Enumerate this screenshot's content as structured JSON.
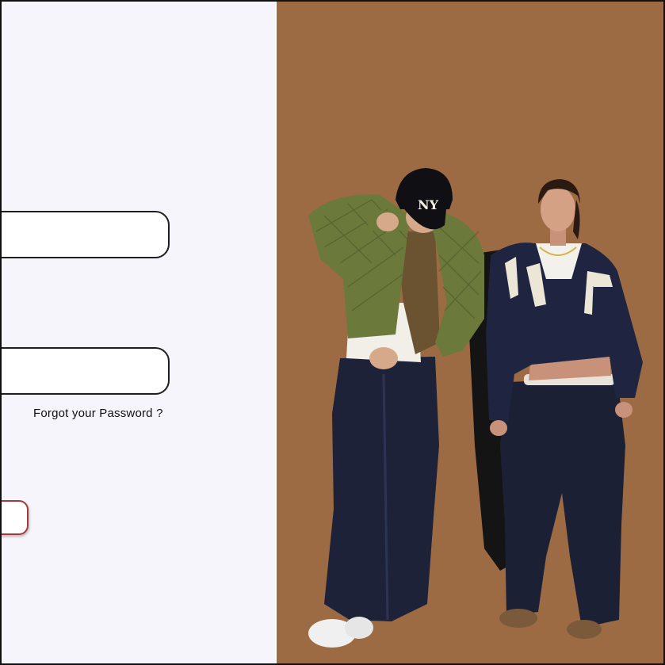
{
  "login_form": {
    "forgot_password_label": "Forgot your Password ?"
  },
  "hero": {
    "image_subject": "two-models-streetwear",
    "cap_logo_text": "NY",
    "colors": {
      "background": "#9c6b43",
      "left_panel": "#f7f5fc",
      "button_border": "#a53a3a",
      "jacket": "#6b7a3a",
      "denim": "#1d2238",
      "hoodie": "#1f2540"
    }
  }
}
